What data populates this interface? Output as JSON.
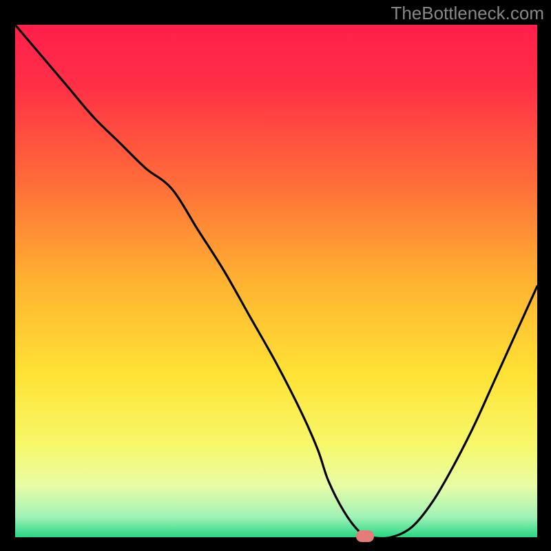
{
  "watermark": "TheBottleneck.com",
  "gradient": {
    "stops": [
      {
        "offset": 0.0,
        "color": "#ff1f4b"
      },
      {
        "offset": 0.12,
        "color": "#ff3046"
      },
      {
        "offset": 0.3,
        "color": "#ff6a3a"
      },
      {
        "offset": 0.5,
        "color": "#ffb231"
      },
      {
        "offset": 0.68,
        "color": "#ffe234"
      },
      {
        "offset": 0.82,
        "color": "#f7f86a"
      },
      {
        "offset": 0.9,
        "color": "#e7fca6"
      },
      {
        "offset": 0.96,
        "color": "#a1f2b7"
      },
      {
        "offset": 1.0,
        "color": "#27d884"
      }
    ]
  },
  "chart_data": {
    "type": "line",
    "title": "",
    "xlabel": "",
    "ylabel": "",
    "xlim": [
      0,
      100
    ],
    "ylim": [
      0,
      100
    ],
    "series": [
      {
        "name": "curve",
        "x": [
          0,
          5,
          10,
          15,
          20,
          25,
          30,
          35,
          40,
          45,
          50,
          55,
          58,
          60,
          63,
          66,
          68,
          72,
          76,
          80,
          84,
          88,
          92,
          96,
          100
        ],
        "y": [
          100,
          94,
          88,
          82,
          77,
          72,
          68,
          60,
          52,
          43,
          34,
          24,
          17,
          11,
          5,
          1,
          0,
          0,
          2,
          7,
          14,
          22,
          31,
          40,
          49
        ]
      }
    ],
    "marker": {
      "x": 67,
      "y": 0
    }
  }
}
